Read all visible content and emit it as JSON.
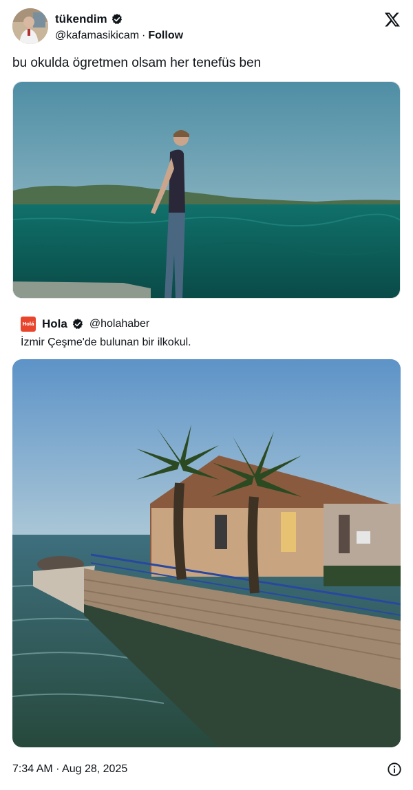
{
  "author": {
    "display_name": "tükendim",
    "handle": "@kafamasikicam",
    "separator": "·",
    "follow_label": "Follow",
    "verified_icon": "verified-badge-icon",
    "avatar_icon": "avatar"
  },
  "tweet": {
    "text": "bu okulda ögretmen olsam her tenefüs ben"
  },
  "quote": {
    "logo_text": "Holá",
    "display_name": "Hola",
    "handle": "@holahaber",
    "text": "İzmir Çeşme'de bulunan bir ilkokul."
  },
  "footer": {
    "timestamp": "7:34 AM · Aug 28, 2025",
    "info_icon": "info-icon"
  },
  "colors": {
    "text": "#0f1419",
    "verified": "#0f1419",
    "hola_brand": "#e8452c",
    "sea": "#0f5a56",
    "sky": "#6fa0b3"
  }
}
